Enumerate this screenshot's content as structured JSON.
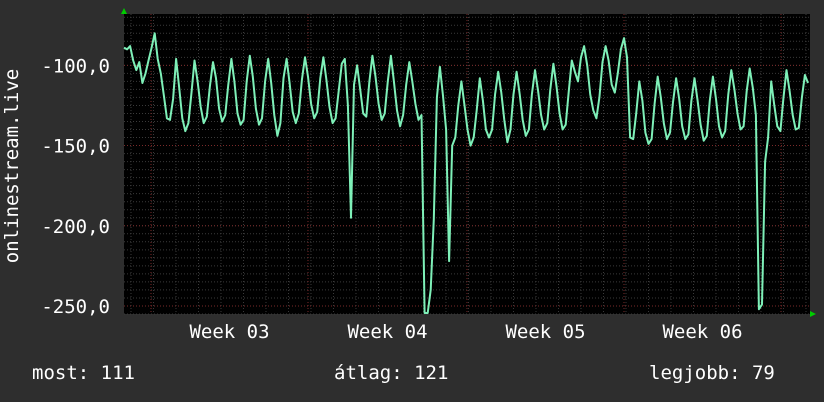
{
  "chart_data": {
    "type": "line",
    "ylabel": "onlinestream.live",
    "ylim": [
      -255,
      -68
    ],
    "y_ticks": [
      {
        "value": -100,
        "label": "-100,0"
      },
      {
        "value": -150,
        "label": "-150,0"
      },
      {
        "value": -200,
        "label": "-200,0"
      },
      {
        "value": -250,
        "label": "-250,0"
      }
    ],
    "x_ticks": [
      "Week 03",
      "Week 04",
      "Week 05",
      "Week 06"
    ],
    "series": [
      {
        "color": "#7ef0b8",
        "values": [
          -89,
          -90,
          -88,
          -97,
          -103,
          -98,
          -111,
          -105,
          -97,
          -89,
          -80,
          -96,
          -105,
          -119,
          -133,
          -134,
          -121,
          -96,
          -114,
          -133,
          -141,
          -136,
          -117,
          -97,
          -110,
          -126,
          -136,
          -132,
          -113,
          -98,
          -108,
          -127,
          -135,
          -131,
          -112,
          -96,
          -110,
          -130,
          -137,
          -134,
          -110,
          -94,
          -107,
          -127,
          -137,
          -133,
          -110,
          -96,
          -111,
          -131,
          -144,
          -136,
          -108,
          -96,
          -111,
          -129,
          -136,
          -130,
          -109,
          -95,
          -107,
          -124,
          -133,
          -129,
          -108,
          -95,
          -109,
          -126,
          -136,
          -133,
          -116,
          -99,
          -96,
          -125,
          -195,
          -112,
          -100,
          -115,
          -130,
          -132,
          -110,
          -94,
          -107,
          -124,
          -134,
          -130,
          -110,
          -94,
          -110,
          -128,
          -138,
          -131,
          -112,
          -98,
          -110,
          -124,
          -134,
          -131,
          -260,
          -262,
          -240,
          -196,
          -120,
          -101,
          -119,
          -140,
          -222,
          -150,
          -145,
          -125,
          -110,
          -125,
          -140,
          -150,
          -145,
          -128,
          -108,
          -122,
          -140,
          -145,
          -140,
          -118,
          -104,
          -117,
          -134,
          -148,
          -140,
          -118,
          -104,
          -118,
          -134,
          -144,
          -140,
          -118,
          -103,
          -116,
          -131,
          -140,
          -136,
          -115,
          -99,
          -113,
          -130,
          -140,
          -137,
          -116,
          -97,
          -104,
          -110,
          -95,
          -88,
          -100,
          -118,
          -128,
          -133,
          -120,
          -98,
          -88,
          -97,
          -112,
          -117,
          -105,
          -90,
          -83,
          -95,
          -145,
          -146,
          -130,
          -110,
          -122,
          -142,
          -149,
          -146,
          -124,
          -107,
          -120,
          -136,
          -146,
          -142,
          -123,
          -108,
          -121,
          -138,
          -146,
          -143,
          -122,
          -108,
          -122,
          -137,
          -147,
          -144,
          -122,
          -107,
          -121,
          -138,
          -145,
          -141,
          -118,
          -103,
          -115,
          -130,
          -140,
          -138,
          -116,
          -102,
          -114,
          -131,
          -252,
          -249,
          -160,
          -145,
          -110,
          -125,
          -138,
          -141,
          -120,
          -103,
          -116,
          -131,
          -140,
          -139,
          -120,
          -106,
          -111
        ]
      }
    ],
    "grid": true
  },
  "stats": {
    "current": "most: 111",
    "average": "átlag: 121",
    "best": "legjobb: 79"
  }
}
